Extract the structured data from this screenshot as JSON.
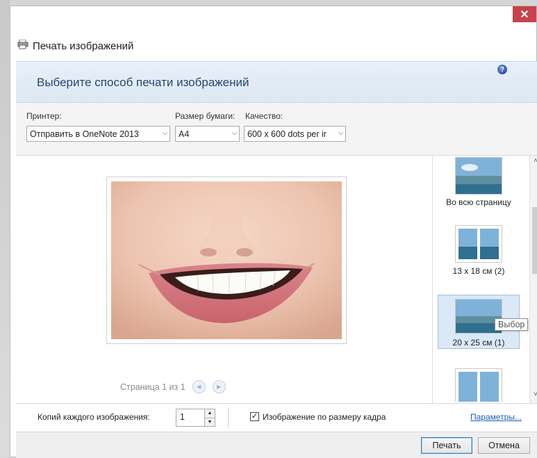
{
  "window": {
    "title": "Печать изображений",
    "close_label": "✕"
  },
  "header": {
    "title": "Выберите способ печати изображений"
  },
  "controls": {
    "printer_label": "Принтер:",
    "printer_value": "Отправить в OneNote 2013",
    "paper_label": "Размер бумаги:",
    "paper_value": "A4",
    "quality_label": "Качество:",
    "quality_value": "600 x 600 dots per ir",
    "help_icon": "?"
  },
  "preview": {
    "pager_text": "Страница 1 из 1"
  },
  "layouts": {
    "items": [
      {
        "label": "Во всю страницу",
        "selected": false
      },
      {
        "label": "13 x 18 см (2)",
        "selected": false
      },
      {
        "label": "20 x 25 см (1)",
        "selected": true
      },
      {
        "label": "",
        "selected": false
      }
    ]
  },
  "tooltip": {
    "text": "Выбор"
  },
  "bottom": {
    "copies_label": "Копий каждого изображения:",
    "copies_value": "1",
    "fit_label": "Изображение по размеру кадра",
    "fit_checked": true,
    "options_link": "Параметры..."
  },
  "footer": {
    "print_label": "Печать",
    "cancel_label": "Отмена"
  },
  "colors": {
    "accent": "#26466d",
    "header_band": "#dde8f3",
    "close": "#c7424a",
    "link": "#1a5fb4"
  }
}
